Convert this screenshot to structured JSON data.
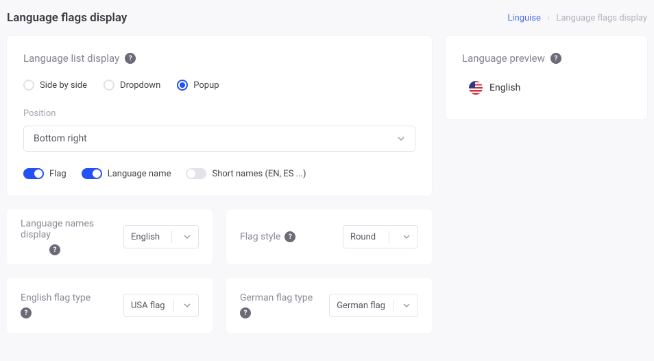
{
  "page": {
    "title": "Language flags display"
  },
  "breadcrumb": {
    "root": "Linguise",
    "current": "Language flags display"
  },
  "list_display": {
    "title": "Language list display",
    "options": {
      "side_by_side": "Side by side",
      "dropdown": "Dropdown",
      "popup": "Popup"
    },
    "position_label": "Position",
    "position_value": "Bottom right",
    "toggles": {
      "flag": "Flag",
      "language_name": "Language name",
      "short_names": "Short names (EN, ES ...)"
    }
  },
  "preview": {
    "title": "Language preview",
    "item": "English"
  },
  "settings": {
    "names_display": {
      "label": "Language names display",
      "value": "English"
    },
    "flag_style": {
      "label": "Flag style",
      "value": "Round"
    },
    "english_flag": {
      "label": "English flag type",
      "value": "USA flag"
    },
    "german_flag": {
      "label": "German flag type",
      "value": "German flag"
    }
  }
}
